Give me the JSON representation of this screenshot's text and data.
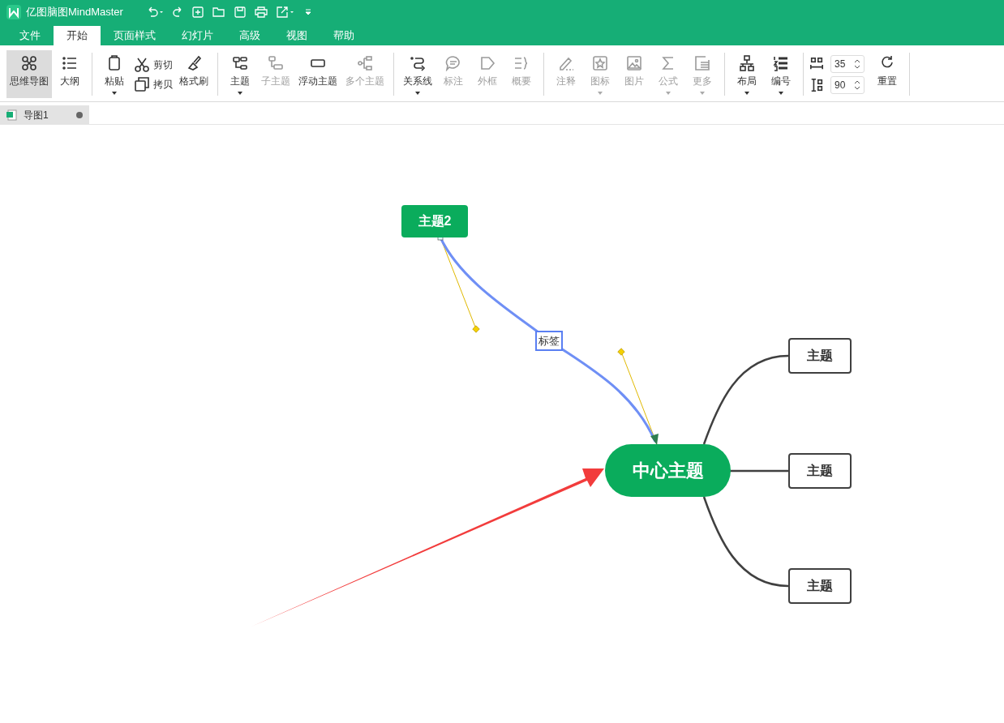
{
  "app": {
    "title": "亿图脑图MindMaster"
  },
  "menu_tabs": [
    {
      "label": "文件",
      "selected": false
    },
    {
      "label": "开始",
      "selected": true
    },
    {
      "label": "页面样式",
      "selected": false
    },
    {
      "label": "幻灯片",
      "selected": false
    },
    {
      "label": "高级",
      "selected": false
    },
    {
      "label": "视图",
      "selected": false
    },
    {
      "label": "帮助",
      "selected": false
    }
  ],
  "toolbar_groups": [
    {
      "items": [
        {
          "kind": "big",
          "label": "思维导图",
          "selected": true,
          "disabled": false,
          "dropdown": false
        },
        {
          "kind": "big",
          "label": "大纲",
          "selected": false,
          "disabled": false,
          "dropdown": false
        }
      ]
    },
    {
      "items": [
        {
          "kind": "big",
          "label": "粘贴",
          "selected": false,
          "disabled": false,
          "dropdown": true
        },
        {
          "kind": "stack",
          "labels": [
            "剪切",
            "拷贝"
          ]
        },
        {
          "kind": "big",
          "label": "格式刷",
          "selected": false,
          "disabled": false,
          "dropdown": false
        }
      ]
    },
    {
      "items": [
        {
          "kind": "big",
          "label": "主题",
          "selected": false,
          "disabled": false,
          "dropdown": true
        },
        {
          "kind": "big",
          "label": "子主题",
          "selected": false,
          "disabled": true,
          "dropdown": false
        },
        {
          "kind": "big",
          "label": "浮动主题",
          "selected": false,
          "disabled": false,
          "dropdown": false
        },
        {
          "kind": "big",
          "label": "多个主题",
          "selected": false,
          "disabled": true,
          "dropdown": false
        }
      ]
    },
    {
      "items": [
        {
          "kind": "big",
          "label": "关系线",
          "selected": false,
          "disabled": false,
          "dropdown": true
        },
        {
          "kind": "big",
          "label": "标注",
          "selected": false,
          "disabled": true,
          "dropdown": false
        },
        {
          "kind": "big",
          "label": "外框",
          "selected": false,
          "disabled": true,
          "dropdown": false
        },
        {
          "kind": "big",
          "label": "概要",
          "selected": false,
          "disabled": true,
          "dropdown": false
        }
      ]
    },
    {
      "items": [
        {
          "kind": "big",
          "label": "注释",
          "selected": false,
          "disabled": true,
          "dropdown": false
        },
        {
          "kind": "big",
          "label": "图标",
          "selected": false,
          "disabled": true,
          "dropdown": true
        },
        {
          "kind": "big",
          "label": "图片",
          "selected": false,
          "disabled": true,
          "dropdown": false
        },
        {
          "kind": "big",
          "label": "公式",
          "selected": false,
          "disabled": true,
          "dropdown": true
        },
        {
          "kind": "big",
          "label": "更多",
          "selected": false,
          "disabled": true,
          "dropdown": true
        }
      ]
    },
    {
      "items": [
        {
          "kind": "big",
          "label": "布局",
          "selected": false,
          "disabled": false,
          "dropdown": true
        },
        {
          "kind": "big",
          "label": "编号",
          "selected": false,
          "disabled": false,
          "dropdown": true
        }
      ]
    },
    {
      "items": [
        {
          "kind": "spinners",
          "values": [
            "35",
            "90"
          ]
        },
        {
          "kind": "big",
          "label": "重置",
          "selected": false,
          "disabled": false,
          "dropdown": false
        }
      ]
    }
  ],
  "document_tab": {
    "title": "导图1",
    "modified": true
  },
  "canvas": {
    "floating_topic": "主题2",
    "relation_label": "标签",
    "central_topic": "中心主题",
    "main_topics": [
      "主题",
      "主题",
      "主题"
    ]
  }
}
